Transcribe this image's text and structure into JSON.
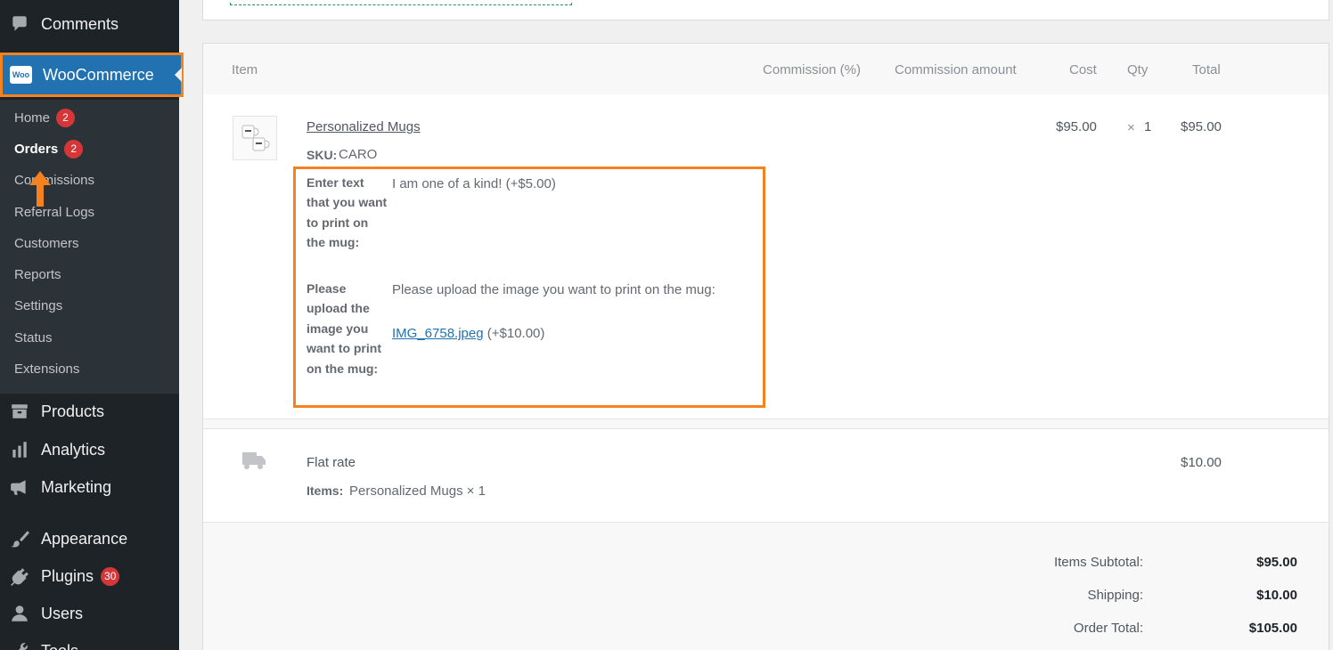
{
  "sidebar": {
    "comments": "Comments",
    "woocommerce": "WooCommerce",
    "woo_logo": "Woo",
    "submenu": [
      {
        "label": "Home",
        "badge": "2"
      },
      {
        "label": "Orders",
        "badge": "2"
      },
      {
        "label": "Commissions"
      },
      {
        "label": "Referral Logs"
      },
      {
        "label": "Customers"
      },
      {
        "label": "Reports"
      },
      {
        "label": "Settings"
      },
      {
        "label": "Status"
      },
      {
        "label": "Extensions"
      }
    ],
    "products": "Products",
    "analytics": "Analytics",
    "marketing": "Marketing",
    "appearance": "Appearance",
    "plugins": "Plugins",
    "plugins_badge": "30",
    "users": "Users",
    "tools": "Tools"
  },
  "table": {
    "headers": {
      "item": "Item",
      "commission_pct": "Commission (%)",
      "commission_amount": "Commission amount",
      "cost": "Cost",
      "qty": "Qty",
      "total": "Total"
    },
    "line_item": {
      "name": "Personalized Mugs",
      "sku_label": "SKU:",
      "sku": "CARO",
      "cost": "$95.00",
      "qty_symbol": "×",
      "qty": "1",
      "total": "$95.00",
      "meta": [
        {
          "label": "Enter text that you want to print on the mug:",
          "value": "I am one of a kind! (+$5.00)"
        },
        {
          "label": "Please upload the image you want to print on the mug:",
          "value": "Please upload the image you want to print on the mug:",
          "file": "IMG_6758.jpeg",
          "price": "(+$10.00)"
        }
      ]
    },
    "shipping": {
      "method": "Flat rate",
      "items_label": "Items:",
      "items": "Personalized Mugs × 1",
      "total": "$10.00"
    }
  },
  "totals": {
    "subtotal_label": "Items Subtotal:",
    "subtotal": "$95.00",
    "shipping_label": "Shipping:",
    "shipping": "$10.00",
    "order_total_label": "Order Total:",
    "order_total": "$105.00"
  },
  "colors": {
    "sidebar_bg": "#1d2327",
    "submenu_bg": "#2c3338",
    "accent_blue": "#2271b1",
    "highlight_orange": "#f5821f",
    "badge_red": "#d63638"
  }
}
